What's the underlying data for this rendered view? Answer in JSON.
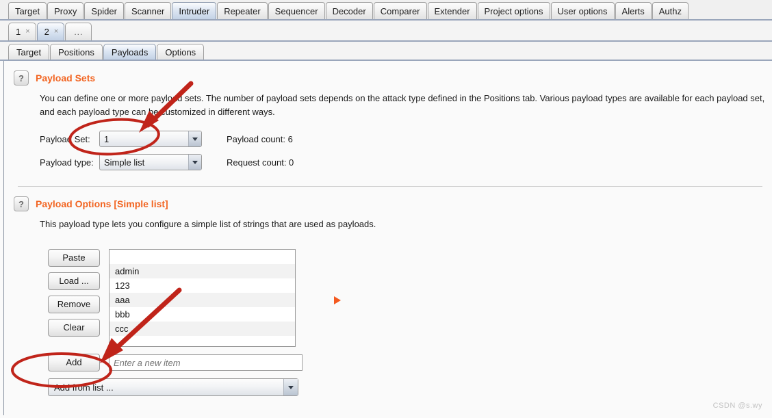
{
  "main_tabs": [
    {
      "label": "Target",
      "active": false
    },
    {
      "label": "Proxy",
      "active": false
    },
    {
      "label": "Spider",
      "active": false
    },
    {
      "label": "Scanner",
      "active": false
    },
    {
      "label": "Intruder",
      "active": true
    },
    {
      "label": "Repeater",
      "active": false
    },
    {
      "label": "Sequencer",
      "active": false
    },
    {
      "label": "Decoder",
      "active": false
    },
    {
      "label": "Comparer",
      "active": false
    },
    {
      "label": "Extender",
      "active": false
    },
    {
      "label": "Project options",
      "active": false
    },
    {
      "label": "User options",
      "active": false
    },
    {
      "label": "Alerts",
      "active": false
    },
    {
      "label": "Authz",
      "active": false
    }
  ],
  "attack_tabs": [
    {
      "label": "1",
      "close": "×",
      "active": false
    },
    {
      "label": "2",
      "close": "×",
      "active": true
    }
  ],
  "attack_tab_more": "...",
  "sub_tabs": [
    {
      "label": "Target",
      "active": false
    },
    {
      "label": "Positions",
      "active": false
    },
    {
      "label": "Payloads",
      "active": true
    },
    {
      "label": "Options",
      "active": false
    }
  ],
  "payload_sets": {
    "help_glyph": "?",
    "title": "Payload Sets",
    "description": "You can define one or more payload sets. The number of payload sets depends on the attack type defined in the Positions tab. Various payload types are available for each payload set, and each payload type can be customized in different ways.",
    "payload_set_label": "Payload Set:",
    "payload_set_value": "1",
    "payload_type_label": "Payload type:",
    "payload_type_value": "Simple list",
    "payload_count": "Payload count:  6",
    "request_count": "Request count:  0"
  },
  "payload_options": {
    "help_glyph": "?",
    "title": "Payload Options [Simple list]",
    "description": "This payload type lets you configure a simple list of strings that are used as payloads.",
    "buttons": [
      {
        "label": "Paste"
      },
      {
        "label": "Load ..."
      },
      {
        "label": "Remove"
      },
      {
        "label": "Clear"
      }
    ],
    "list_items": [
      "admin",
      "123",
      "aaa",
      "bbb",
      "ccc"
    ],
    "add_button": "Add",
    "new_item_placeholder": "Enter a new item",
    "new_item_value": "",
    "add_from_list": "Add from list ..."
  },
  "colors": {
    "accent_orange": "#f26522",
    "marker_orange": "#f4591f",
    "annotation_red": "#c0241a",
    "tab_active_blue": "#c2d1e5"
  },
  "watermark": "CSDN @s.wy"
}
